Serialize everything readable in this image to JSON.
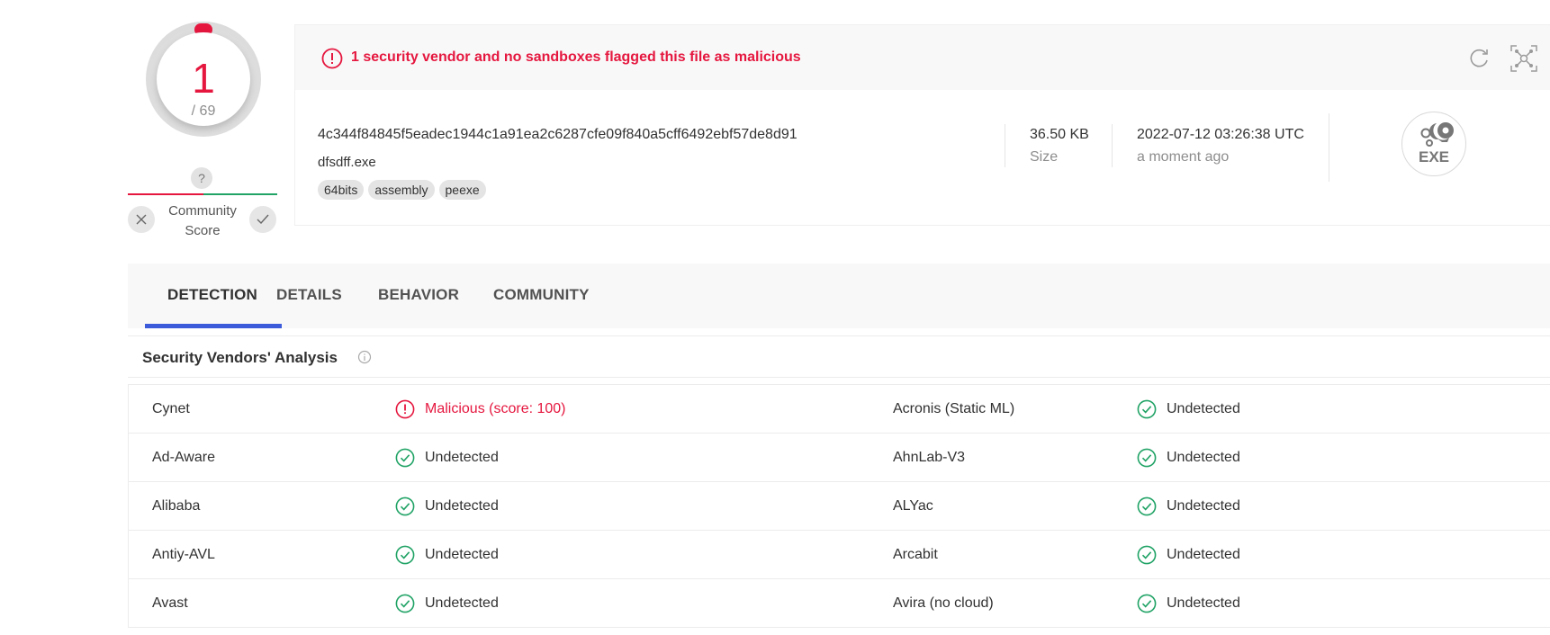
{
  "score": {
    "detections": "1",
    "total": "/ 69",
    "accent_color": "#e5173f"
  },
  "community": {
    "question_icon": "?",
    "label": "Community Score",
    "negative_icon": "close-icon",
    "positive_icon": "check-icon"
  },
  "alert": {
    "text": "1 security vendor and no sandboxes flagged this file as malicious",
    "color": "#e5173f"
  },
  "file": {
    "hash": "4c344f84845f5eadec1944c1a91ea2c6287cfe09f840a5cff6492ebf57de8d91",
    "name": "dfsdff.exe",
    "tags": [
      "64bits",
      "assembly",
      "peexe"
    ],
    "size_value": "36.50 KB",
    "size_label": "Size",
    "date_value": "2022-07-12 03:26:38 UTC",
    "date_label": "a moment ago",
    "type_icon_label": "EXE"
  },
  "tabs": [
    {
      "label": "DETECTION",
      "active": true
    },
    {
      "label": "DETAILS",
      "active": false
    },
    {
      "label": "BEHAVIOR",
      "active": false
    },
    {
      "label": "COMMUNITY",
      "active": false
    }
  ],
  "section": {
    "title": "Security Vendors' Analysis"
  },
  "colors": {
    "malicious": "#e5173f",
    "clean": "#21a366",
    "tab_underline": "#3b5bdb"
  },
  "vendors": [
    {
      "left": {
        "name": "Cynet",
        "result": "Malicious (score: 100)",
        "status": "malicious"
      },
      "right": {
        "name": "Acronis (Static ML)",
        "result": "Undetected",
        "status": "clean"
      }
    },
    {
      "left": {
        "name": "Ad-Aware",
        "result": "Undetected",
        "status": "clean"
      },
      "right": {
        "name": "AhnLab-V3",
        "result": "Undetected",
        "status": "clean"
      }
    },
    {
      "left": {
        "name": "Alibaba",
        "result": "Undetected",
        "status": "clean"
      },
      "right": {
        "name": "ALYac",
        "result": "Undetected",
        "status": "clean"
      }
    },
    {
      "left": {
        "name": "Antiy-AVL",
        "result": "Undetected",
        "status": "clean"
      },
      "right": {
        "name": "Arcabit",
        "result": "Undetected",
        "status": "clean"
      }
    },
    {
      "left": {
        "name": "Avast",
        "result": "Undetected",
        "status": "clean"
      },
      "right": {
        "name": "Avira (no cloud)",
        "result": "Undetected",
        "status": "clean"
      }
    }
  ]
}
